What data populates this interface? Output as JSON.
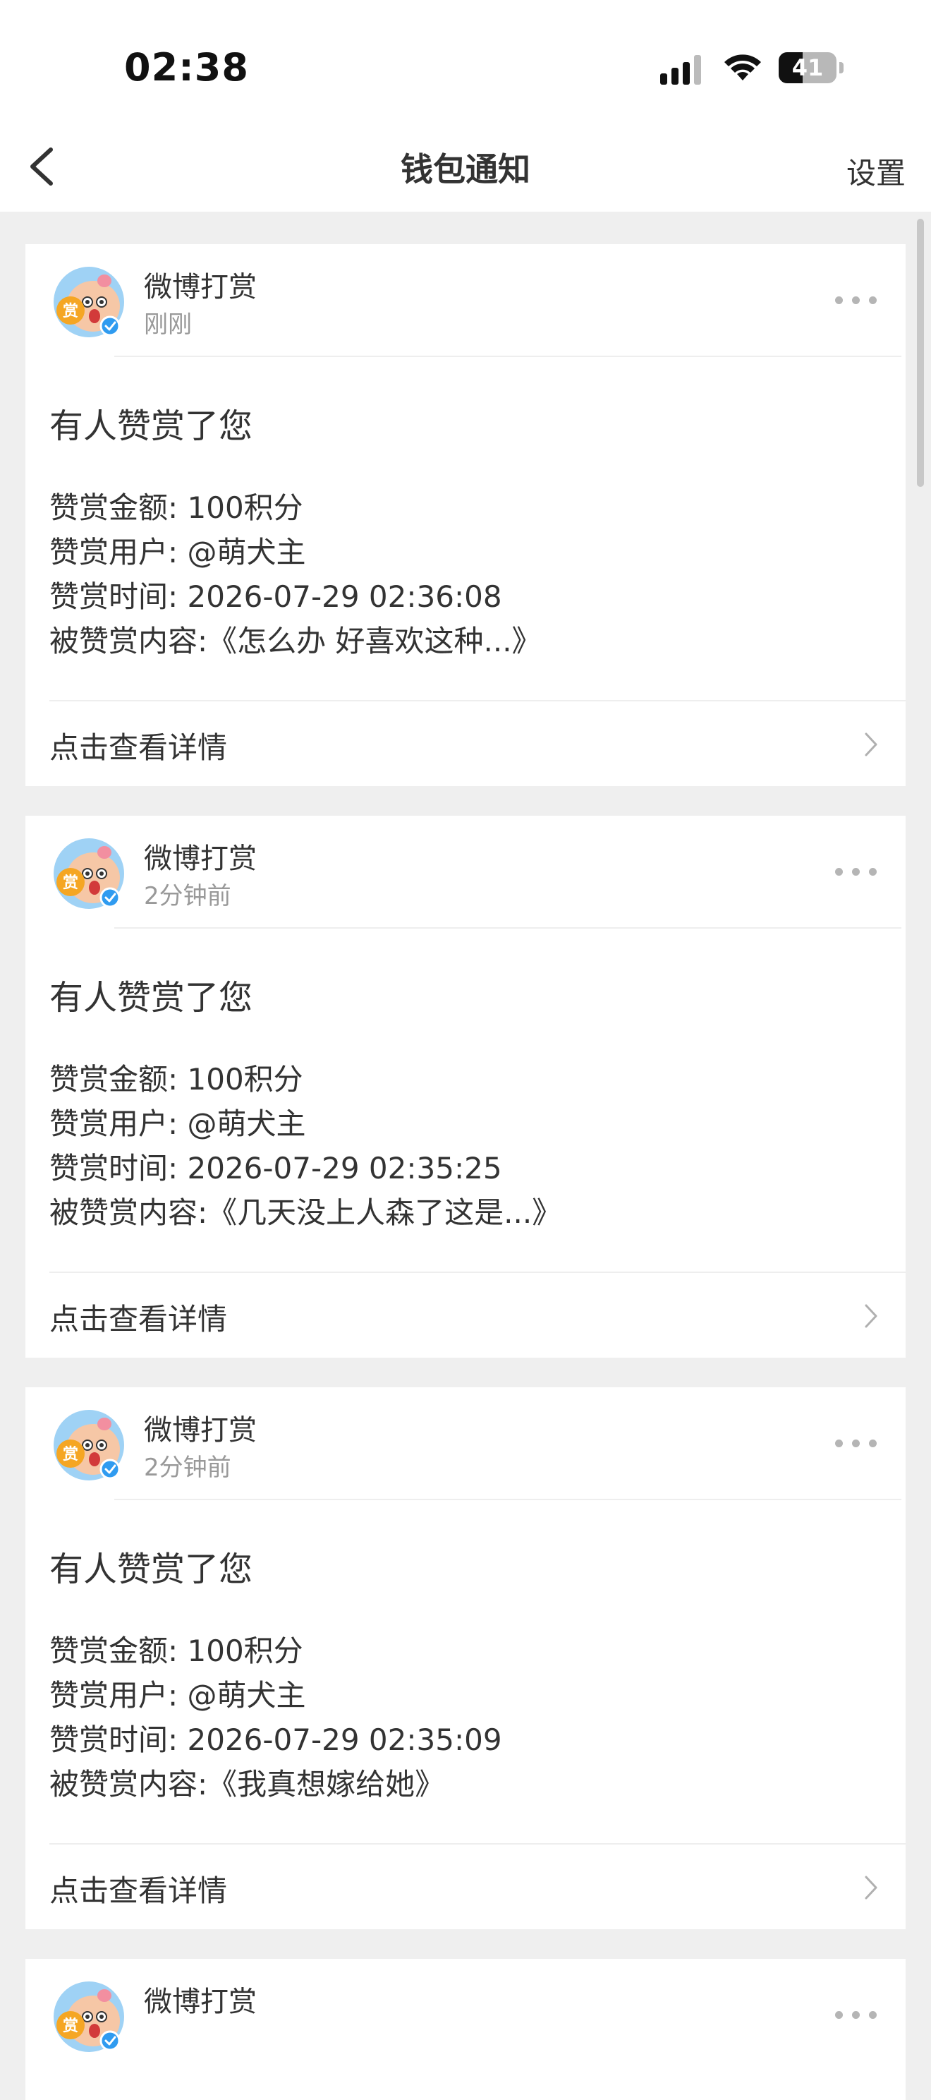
{
  "status_bar": {
    "time": "02:38",
    "battery_level": "41",
    "battery_fraction": 0.41,
    "icons": [
      "cellular-signal-icon",
      "wifi-icon",
      "battery-icon"
    ]
  },
  "nav": {
    "title": "钱包通知",
    "settings_label": "设置",
    "back_icon": "chevron-left-icon"
  },
  "notifications": [
    {
      "sender": "微博打赏",
      "time": "刚刚",
      "title": "有人赞赏了您",
      "amount": "赞赏金额: 100积分",
      "user": "赞赏用户: @萌犬主",
      "reward_time": "赞赏时间: 2026-07-29 02:36:08",
      "content": "被赞赏内容:《怎么办 好喜欢这种...》",
      "view_details": "点击查看详情"
    },
    {
      "sender": "微博打赏",
      "time": "2分钟前",
      "title": "有人赞赏了您",
      "amount": "赞赏金额: 100积分",
      "user": "赞赏用户: @萌犬主",
      "reward_time": "赞赏时间: 2026-07-29 02:35:25",
      "content": "被赞赏内容:《几天没上人森了这是...》",
      "view_details": "点击查看详情"
    },
    {
      "sender": "微博打赏",
      "time": "2分钟前",
      "title": "有人赞赏了您",
      "amount": "赞赏金额: 100积分",
      "user": "赞赏用户: @萌犬主",
      "reward_time": "赞赏时间: 2026-07-29 02:35:09",
      "content": "被赞赏内容:《我真想嫁给她》",
      "view_details": "点击查看详情"
    },
    {
      "sender": "微博打赏"
    }
  ],
  "avatar": {
    "badge_text": "赏",
    "verified_icon": "verified-check-icon"
  },
  "colors": {
    "background": "#efefef",
    "card": "#ffffff",
    "primary_text": "#333333",
    "secondary_text": "#999999",
    "verified_blue": "#2f9bf0",
    "badge_gold": "#f5a623"
  }
}
